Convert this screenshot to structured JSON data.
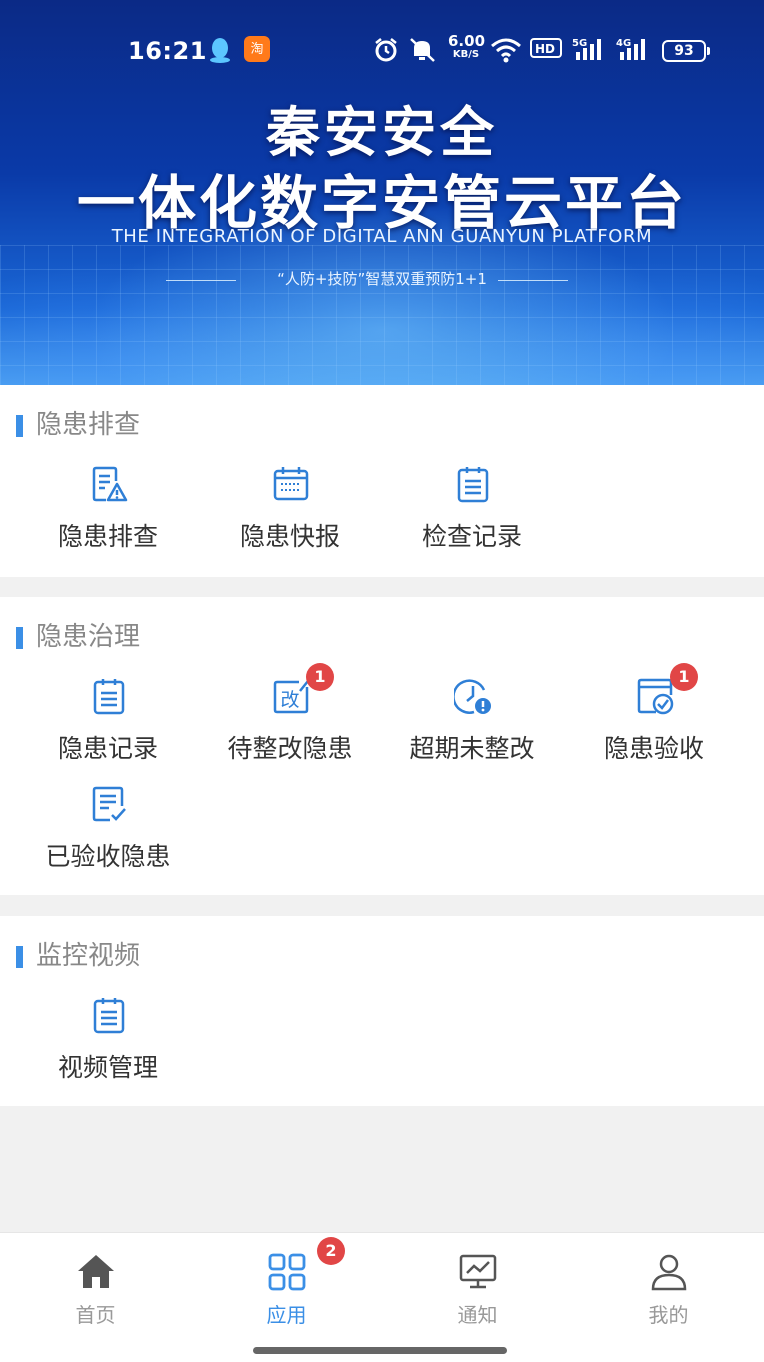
{
  "status_bar": {
    "time": "16:21",
    "net_speed": "6.00",
    "net_unit": "KB/S",
    "battery": "93",
    "icons": [
      "qq-icon",
      "taobao-icon",
      "alarm-icon",
      "mute-icon",
      "wifi-icon",
      "hd-icon",
      "signal-5g-icon",
      "signal-4g-icon"
    ]
  },
  "banner": {
    "title_line1": "秦安安全",
    "title_line2": "一体化数字安管云平台",
    "subtitle_en": "THE INTEGRATION OF DIGITAL ANN GUANYUN PLATFORM",
    "tagline": "“人防+技防”智慧双重预防1+1"
  },
  "sections": [
    {
      "title": "隐患排查",
      "items": [
        {
          "label": "隐患排查",
          "icon": "checklist-warning-icon"
        },
        {
          "label": "隐患快报",
          "icon": "calendar-icon"
        },
        {
          "label": "检查记录",
          "icon": "clipboard-icon"
        }
      ]
    },
    {
      "title": "隐患治理",
      "items": [
        {
          "label": "隐患记录",
          "icon": "clipboard-icon"
        },
        {
          "label": "待整改隐患",
          "icon": "edit-correct-icon",
          "badge": "1"
        },
        {
          "label": "超期未整改",
          "icon": "clock-alert-icon"
        },
        {
          "label": "隐患验收",
          "icon": "window-check-icon",
          "badge": "1"
        },
        {
          "label": "已验收隐患",
          "icon": "document-check-icon"
        }
      ]
    },
    {
      "title": "监控视频",
      "items": [
        {
          "label": "视频管理",
          "icon": "clipboard-icon"
        }
      ]
    }
  ],
  "tabbar": {
    "tabs": [
      {
        "label": "首页",
        "icon": "home-icon"
      },
      {
        "label": "应用",
        "icon": "apps-grid-icon",
        "badge": "2",
        "active": true
      },
      {
        "label": "通知",
        "icon": "monitor-chart-icon"
      },
      {
        "label": "我的",
        "icon": "user-icon"
      }
    ]
  },
  "colors": {
    "accent": "#3b8fe6",
    "badge": "#e14646",
    "icon_blue": "#2f7fd6",
    "inactive_tab": "#999999"
  }
}
